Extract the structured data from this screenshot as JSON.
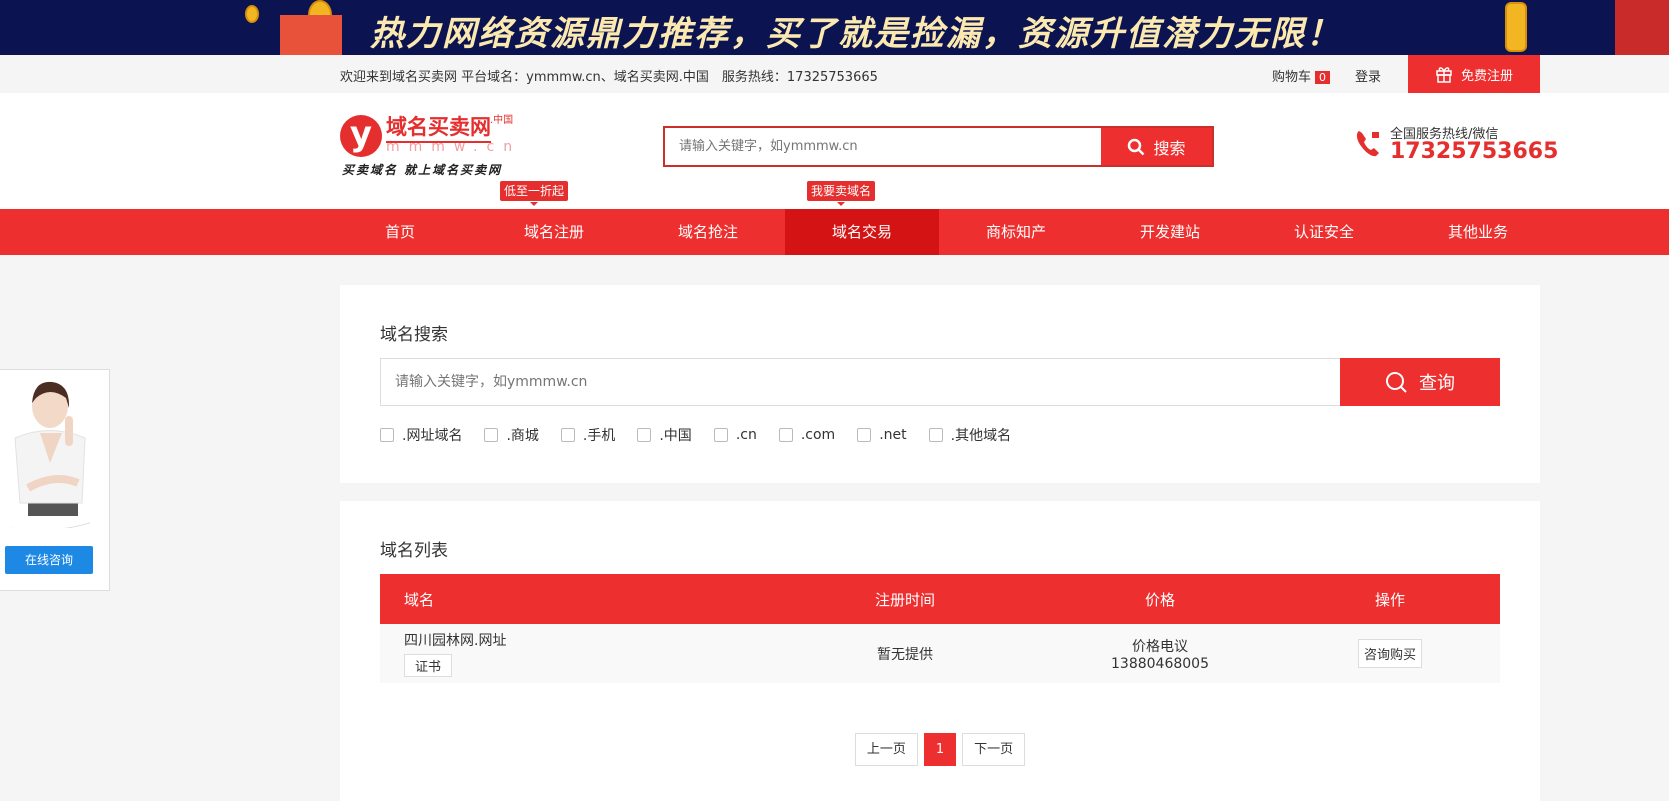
{
  "banner": {
    "text": "热力网络资源鼎力推荐，买了就是捡漏，资源升值潜力无限！"
  },
  "topbar": {
    "welcome": "欢迎来到域名买卖网 平台域名：ymmmw.cn、域名买卖网.中国　服务热线：17325753665",
    "cart": "购物车",
    "cart_count": "0",
    "login": "登录",
    "register": "免费注册"
  },
  "header": {
    "logo": {
      "name": "域名买卖网",
      "suffix": ".中国",
      "domain": "mmmw.cn",
      "letter": "y",
      "slogan": "买卖域名 就上域名买卖网"
    },
    "search_placeholder": "请输入关键字，如ymmmw.cn",
    "search_button": "搜索",
    "hotline_label": "全国服务热线/微信",
    "hotline_number": "17325753665"
  },
  "nav": {
    "items": [
      "首页",
      "域名注册",
      "域名抢注",
      "域名交易",
      "商标知产",
      "开发建站",
      "认证安全",
      "其他业务"
    ],
    "active": "域名交易",
    "tips": [
      "低至一折起",
      "我要卖域名"
    ]
  },
  "search_panel": {
    "title": "域名搜索",
    "placeholder": "请输入关键字，如ymmmw.cn",
    "button": "查询",
    "filters": [
      ".网址域名",
      ".商城",
      ".手机",
      ".中国",
      ".cn",
      ".com",
      ".net",
      ".其他域名"
    ]
  },
  "list_panel": {
    "title": "域名列表",
    "columns": [
      "域名",
      "注册时间",
      "价格",
      "操作"
    ],
    "rows": [
      {
        "domain": "四川园林网.网址",
        "cert": "证书",
        "reg_time": "暂无提供",
        "price": "价格电议",
        "phone": "13880468005",
        "action": "咨询购买"
      }
    ]
  },
  "pagination": {
    "prev": "上一页",
    "current": "1",
    "next": "下一页"
  },
  "chat": {
    "button": "在线咨询"
  },
  "colors": {
    "brand_red": "#ee2f2f",
    "nav_active": "#d41414",
    "chat_blue": "#1e88e5",
    "banner_bg": "#0b1450"
  }
}
